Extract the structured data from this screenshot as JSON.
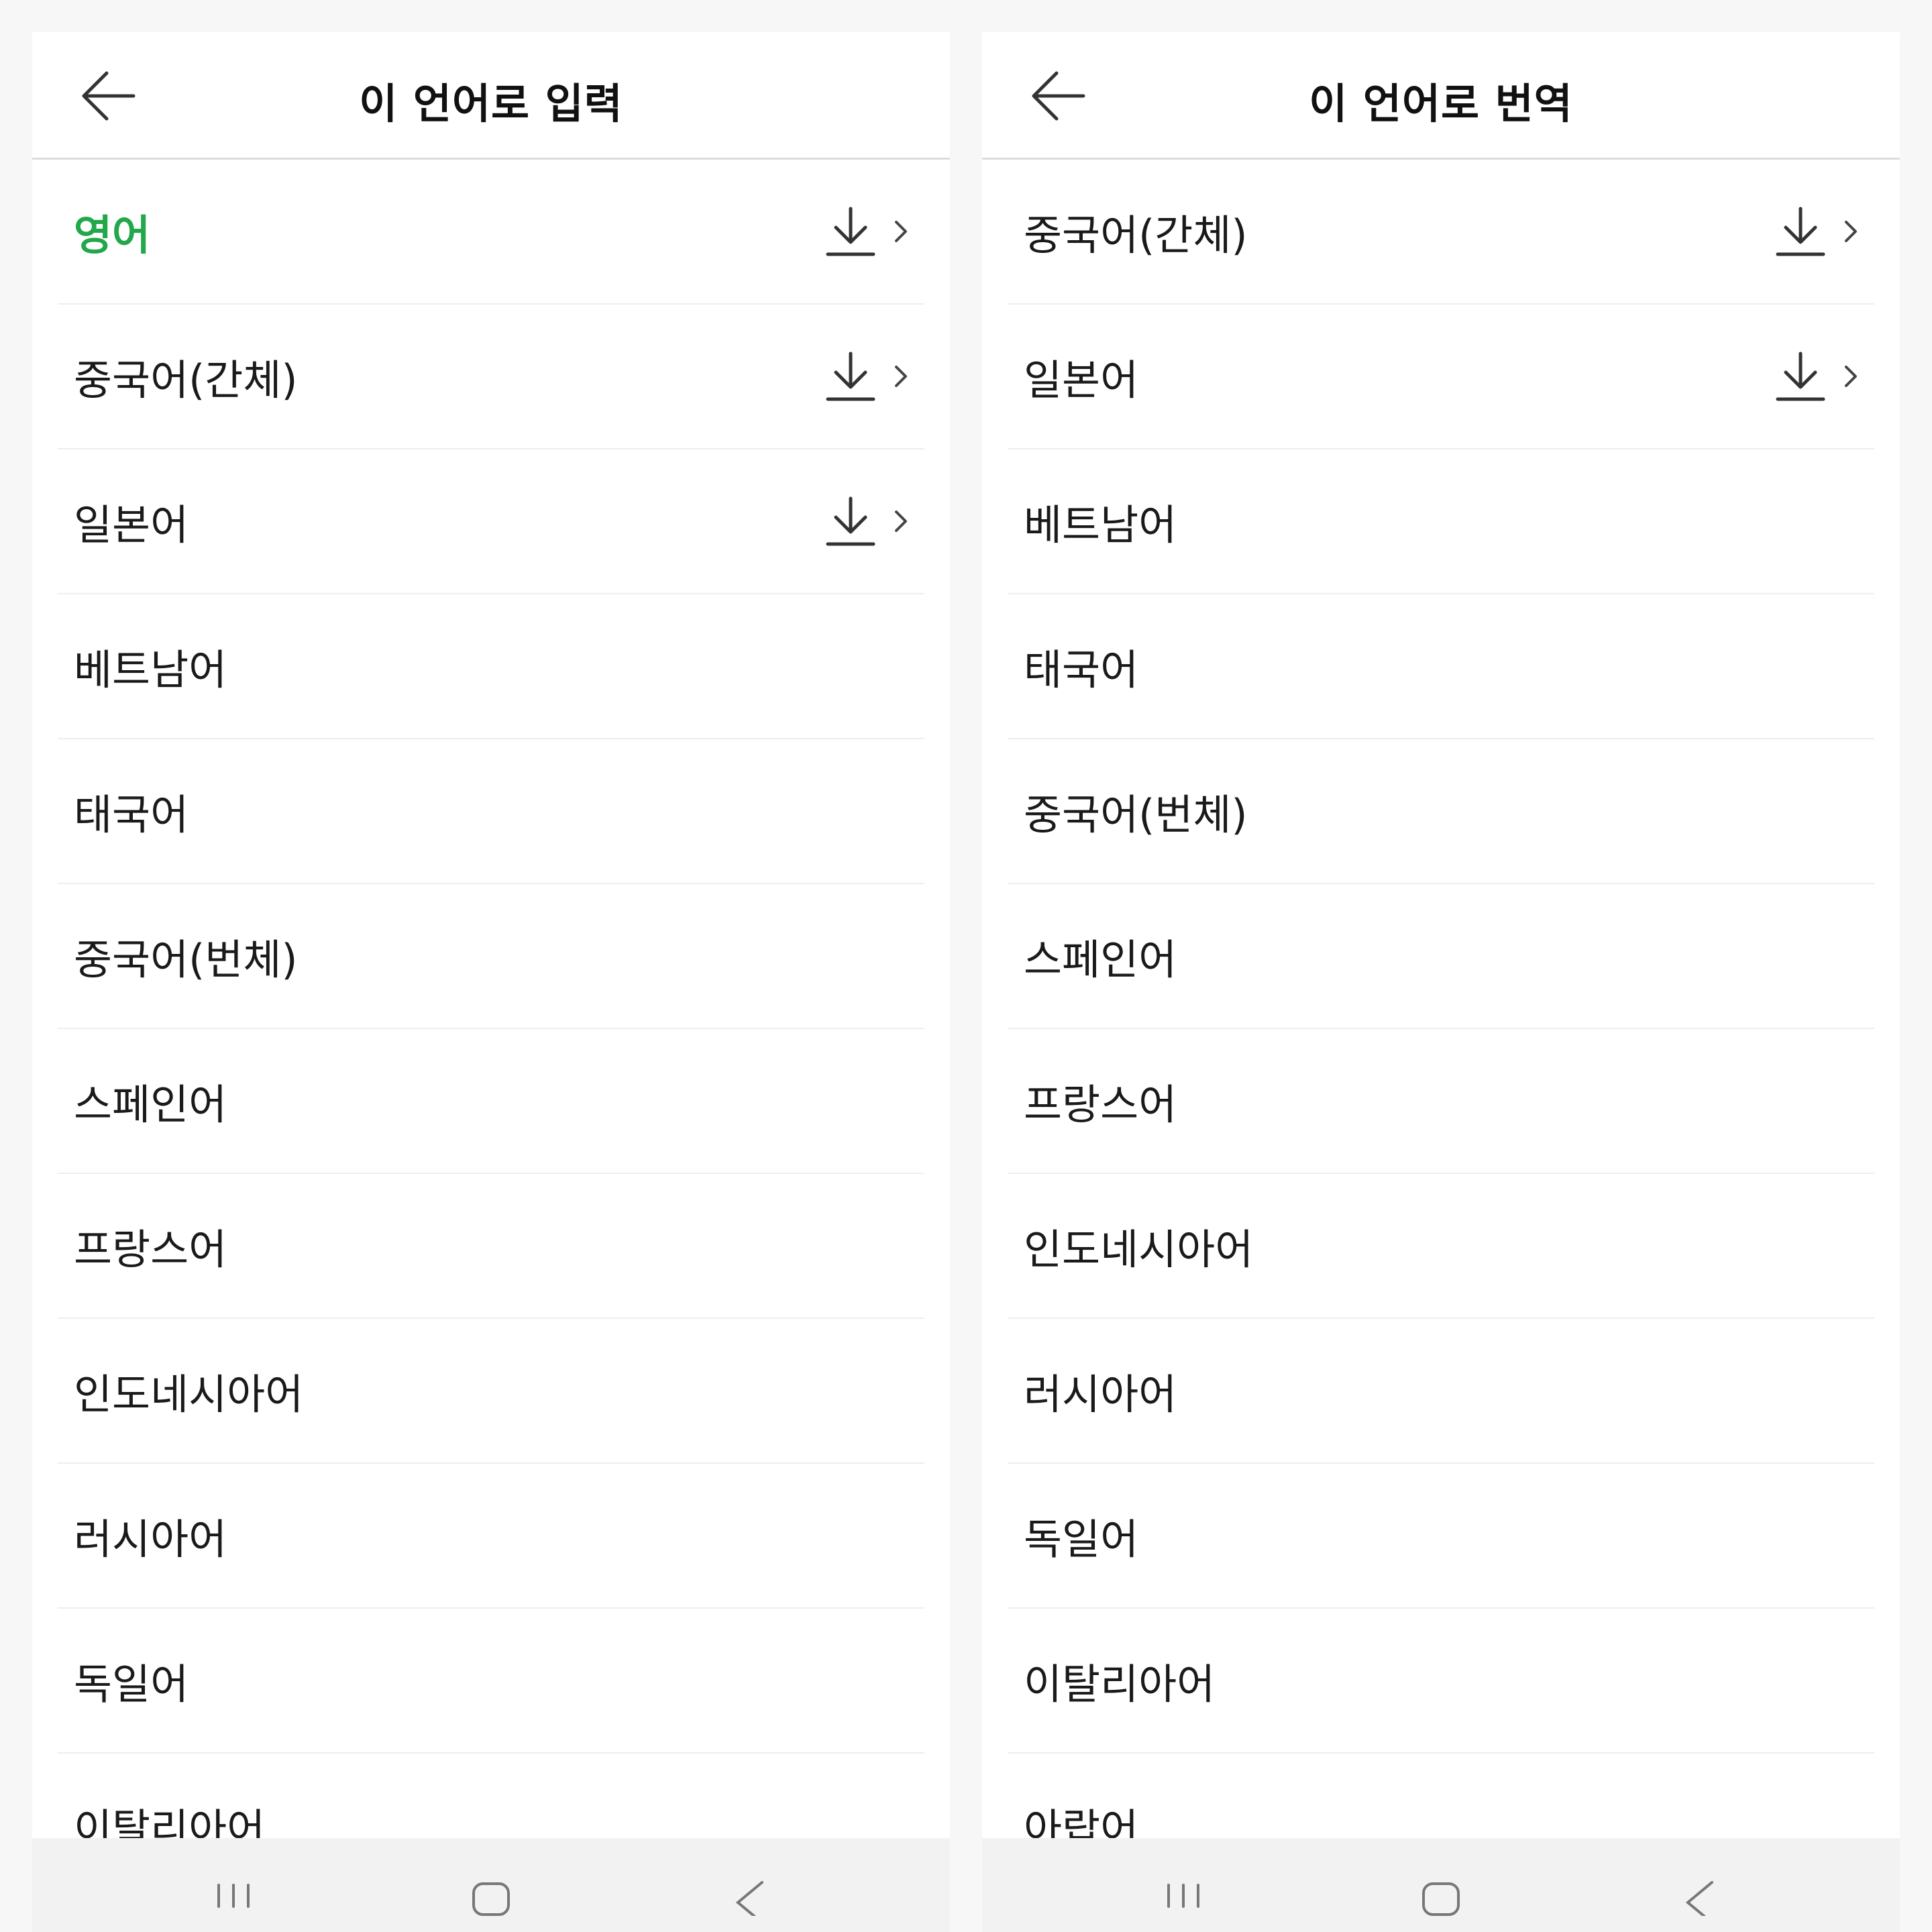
{
  "left_panel": {
    "title": "이 언어로 입력",
    "items": [
      {
        "label": "영어",
        "selected": true,
        "download": true
      },
      {
        "label": "중국어(간체)",
        "download": true
      },
      {
        "label": "일본어",
        "download": true
      },
      {
        "label": "베트남어"
      },
      {
        "label": "태국어"
      },
      {
        "label": "중국어(번체)"
      },
      {
        "label": "스페인어"
      },
      {
        "label": "프랑스어"
      },
      {
        "label": "인도네시아어"
      },
      {
        "label": "러시아어"
      },
      {
        "label": "독일어"
      },
      {
        "label": "이탈리아어"
      }
    ]
  },
  "right_panel": {
    "title": "이 언어로 번역",
    "items": [
      {
        "label": "중국어(간체)",
        "download": true
      },
      {
        "label": "일본어",
        "download": true
      },
      {
        "label": "베트남어"
      },
      {
        "label": "태국어"
      },
      {
        "label": "중국어(번체)"
      },
      {
        "label": "스페인어"
      },
      {
        "label": "프랑스어"
      },
      {
        "label": "인도네시아어"
      },
      {
        "label": "러시아어"
      },
      {
        "label": "독일어"
      },
      {
        "label": "이탈리아어"
      },
      {
        "label": "아랍어"
      }
    ]
  },
  "icons": {
    "back": "arrow-left-icon",
    "download": "download-icon",
    "chevron": "chevron-right-icon",
    "nav_recent": "recent-apps-icon",
    "nav_home": "home-icon",
    "nav_back": "back-icon"
  },
  "colors": {
    "selected": "#22a74a",
    "text": "#1a1a1a",
    "divider": "#eeeeee",
    "navbar": "#f2f2f2"
  }
}
